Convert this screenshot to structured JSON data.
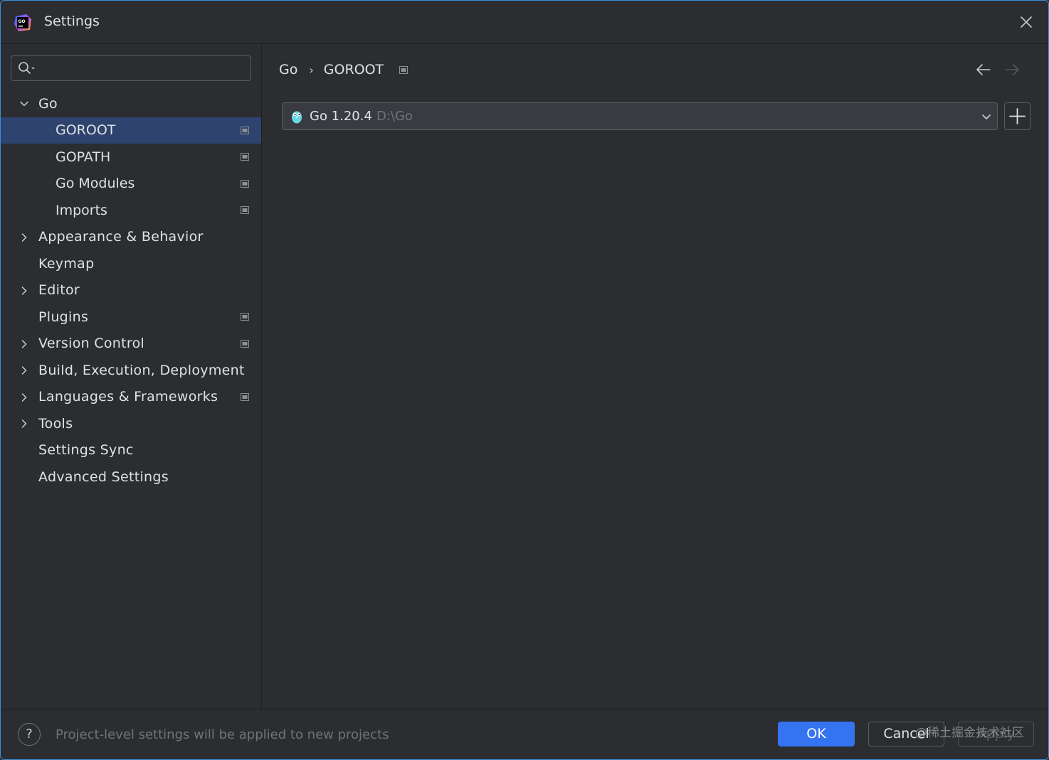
{
  "window": {
    "title": "Settings"
  },
  "search": {
    "value": "",
    "placeholder": ""
  },
  "sidebar": {
    "items": [
      {
        "label": "Go",
        "level": 0,
        "arrow": "expanded",
        "project": false,
        "selected": false
      },
      {
        "label": "GOROOT",
        "level": 1,
        "arrow": "none",
        "project": true,
        "selected": true
      },
      {
        "label": "GOPATH",
        "level": 1,
        "arrow": "none",
        "project": true,
        "selected": false
      },
      {
        "label": "Go Modules",
        "level": 1,
        "arrow": "none",
        "project": true,
        "selected": false
      },
      {
        "label": "Imports",
        "level": 1,
        "arrow": "none",
        "project": true,
        "selected": false
      },
      {
        "label": "Appearance & Behavior",
        "level": 0,
        "arrow": "collapsed",
        "project": false,
        "selected": false
      },
      {
        "label": "Keymap",
        "level": 0,
        "arrow": "none",
        "project": false,
        "selected": false
      },
      {
        "label": "Editor",
        "level": 0,
        "arrow": "collapsed",
        "project": false,
        "selected": false
      },
      {
        "label": "Plugins",
        "level": 0,
        "arrow": "none",
        "project": true,
        "selected": false
      },
      {
        "label": "Version Control",
        "level": 0,
        "arrow": "collapsed",
        "project": true,
        "selected": false
      },
      {
        "label": "Build, Execution, Deployment",
        "level": 0,
        "arrow": "collapsed",
        "project": false,
        "selected": false
      },
      {
        "label": "Languages & Frameworks",
        "level": 0,
        "arrow": "collapsed",
        "project": true,
        "selected": false
      },
      {
        "label": "Tools",
        "level": 0,
        "arrow": "collapsed",
        "project": false,
        "selected": false
      },
      {
        "label": "Settings Sync",
        "level": 0,
        "arrow": "none",
        "project": false,
        "selected": false
      },
      {
        "label": "Advanced Settings",
        "level": 0,
        "arrow": "none",
        "project": false,
        "selected": false
      }
    ]
  },
  "breadcrumb": {
    "parent": "Go",
    "separator": "›",
    "current": "GOROOT"
  },
  "sdk": {
    "name": "Go 1.20.4",
    "path": "D:\\Go"
  },
  "footer": {
    "help_label": "?",
    "note": "Project-level settings will be applied to new projects",
    "ok_label": "OK",
    "cancel_label": "Cancel",
    "apply_label": "Apply",
    "watermark": "@稀土掘金技术社区"
  },
  "colors": {
    "background": "#2b2d30",
    "selection": "#2e436e",
    "accent": "#3574f0",
    "window_border": "#3b8fd6"
  },
  "icons": {
    "app": "goland-logo-icon",
    "close": "close-icon",
    "search": "search-icon",
    "project": "project-level-icon",
    "back": "arrow-left-icon",
    "forward": "arrow-right-icon",
    "sdk": "gopher-icon",
    "dropdown": "chevron-down-icon",
    "add": "plus-icon"
  }
}
